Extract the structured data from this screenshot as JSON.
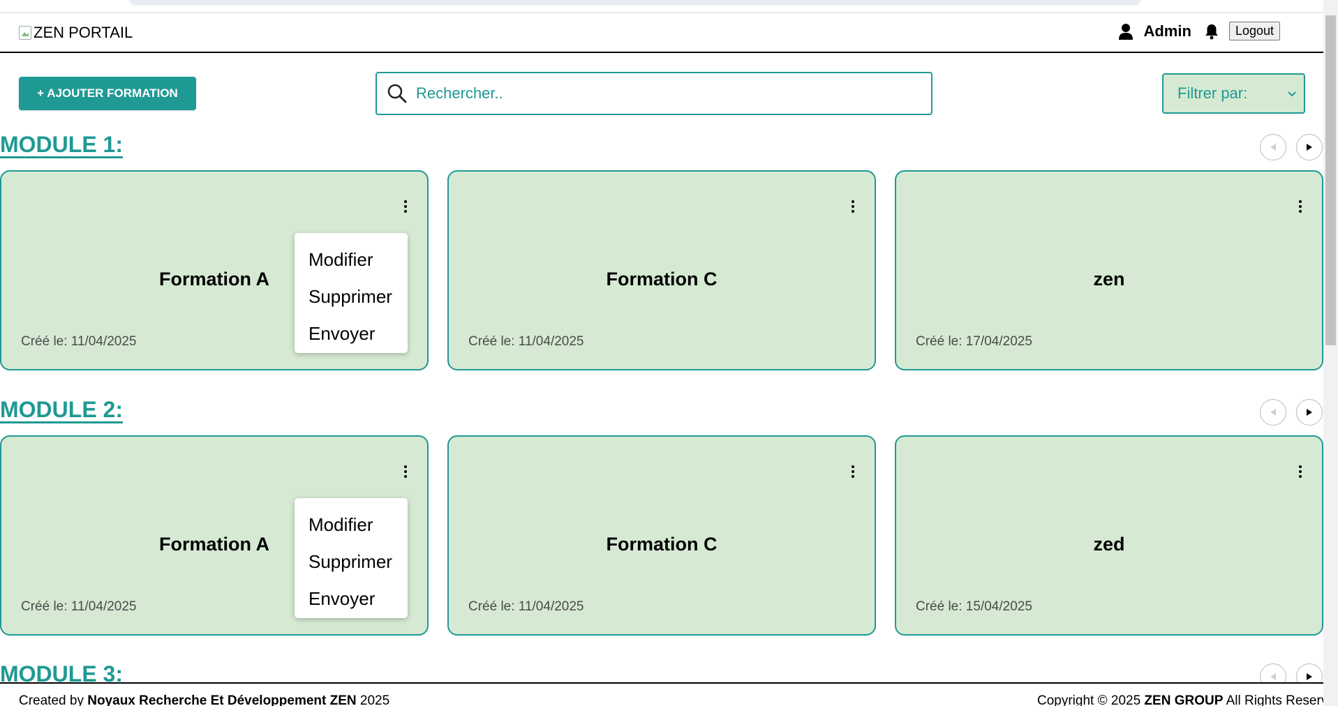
{
  "header": {
    "logo_text": "ZEN PORTAIL",
    "user_name": "Admin",
    "logout_label": "Logout"
  },
  "toolbar": {
    "add_label": "+ AJOUTER FORMATION",
    "search_placeholder": "Rechercher..",
    "filter_label": "Filtrer par:"
  },
  "modules": [
    {
      "title": "MODULE 1:",
      "cards": [
        {
          "title": "Formation A",
          "date": "Créé le: 11/04/2025"
        },
        {
          "title": "Formation C",
          "date": "Créé le: 11/04/2025"
        },
        {
          "title": "zen",
          "date": "Créé le: 17/04/2025"
        }
      ]
    },
    {
      "title": "MODULE 2:",
      "cards": [
        {
          "title": "Formation A",
          "date": "Créé le: 11/04/2025"
        },
        {
          "title": "Formation C",
          "date": "Créé le: 11/04/2025"
        },
        {
          "title": "zed",
          "date": "Créé le: 15/04/2025"
        }
      ]
    },
    {
      "title": "MODULE 3:"
    }
  ],
  "context_menu": {
    "items": [
      "Modifier",
      "Supprimer",
      "Envoyer"
    ]
  },
  "footer": {
    "created_prefix": "Created by ",
    "created_org": "Noyaux Recherche Et Développement ZEN",
    "created_year": " 2025",
    "copyright_prefix": "Copyright © 2025 ",
    "copyright_org": "ZEN GROUP",
    "copyright_suffix": " All Rights Reserved"
  },
  "colors": {
    "accent": "#1f9994",
    "card_bg": "#d6ead3"
  }
}
